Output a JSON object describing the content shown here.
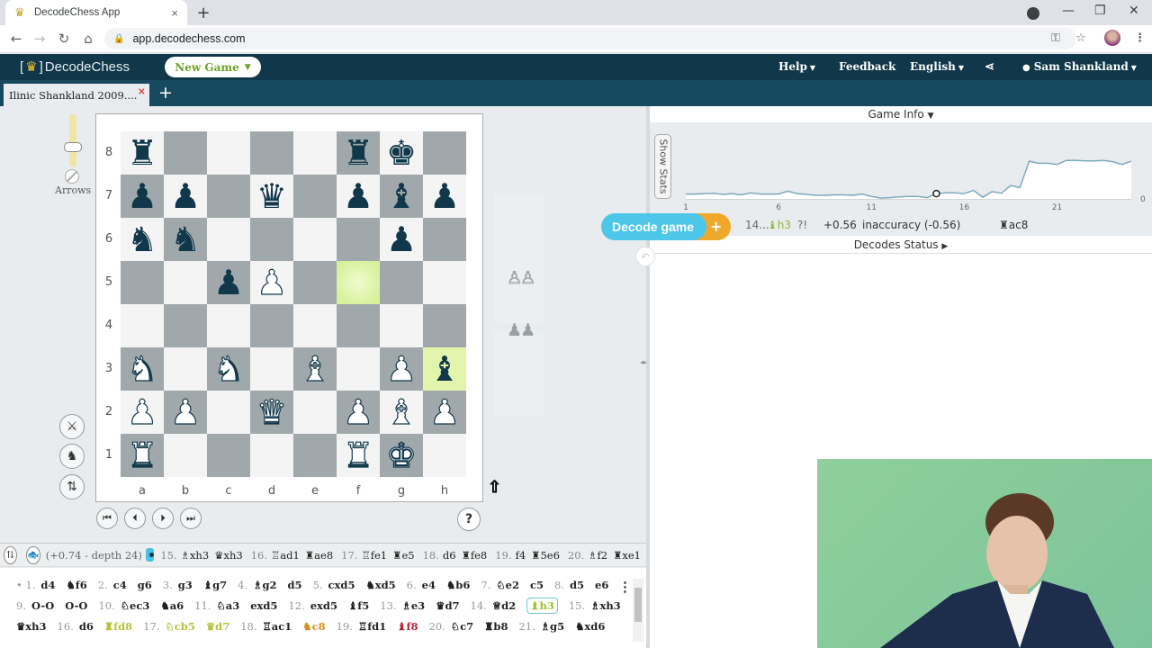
{
  "browser": {
    "tab_title": "DecodeChess App",
    "tab_close": "×",
    "new_tab": "+",
    "url": "app.decodechess.com",
    "window_controls": {
      "minimize": "—",
      "maximize": "❐",
      "close": "✕"
    }
  },
  "app": {
    "logo_text": "DecodeChess",
    "new_game_label": "New Game",
    "nav": {
      "help": "Help",
      "feedback": "Feedback",
      "language": "English",
      "user": "Sam Shankland"
    },
    "game_tab": {
      "label": "Ilinic Shankland 2009....",
      "close": "×",
      "add": "+"
    }
  },
  "board": {
    "arrows_label": "Arrows",
    "arrows_slider_value": 0.25,
    "ranks": [
      "8",
      "7",
      "6",
      "5",
      "4",
      "3",
      "2",
      "1"
    ],
    "files": [
      "a",
      "b",
      "c",
      "d",
      "e",
      "f",
      "g",
      "h"
    ],
    "position": [
      [
        "bR",
        "",
        "",
        "",
        "",
        "bR",
        "bK",
        ""
      ],
      [
        "bP",
        "bP",
        "",
        "bQ",
        "",
        "bP",
        "bB",
        "bP"
      ],
      [
        "bN",
        "bN",
        "",
        "",
        "",
        "",
        "bP",
        ""
      ],
      [
        "",
        "",
        "bP",
        "wP",
        "",
        "",
        "",
        ""
      ],
      [
        "",
        "",
        "",
        "",
        "",
        "",
        "",
        ""
      ],
      [
        "wN",
        "",
        "wN",
        "",
        "wB",
        "",
        "wP",
        "bB"
      ],
      [
        "wP",
        "wP",
        "",
        "wQ",
        "",
        "wP",
        "wB",
        "wP"
      ],
      [
        "wR",
        "",
        "",
        "",
        "",
        "wR",
        "wK",
        ""
      ]
    ],
    "highlighted_squares": [
      "f5",
      "h3"
    ],
    "captured_white": "♙♙",
    "captured_black": "♟♟",
    "help_label": "?",
    "side_buttons": [
      "sword-icon",
      "knights-icon",
      "flip-icon"
    ],
    "nav_buttons": [
      "⏮",
      "⏴",
      "⏵",
      "⏭"
    ]
  },
  "engine_line": {
    "eval": "(+0.74 - depth 24)",
    "moves": [
      {
        "num": "15.",
        "san": "♗xh3"
      },
      {
        "num": "",
        "san": "♛xh3"
      },
      {
        "num": "16.",
        "san": "♖ad1"
      },
      {
        "num": "",
        "san": "♜ae8"
      },
      {
        "num": "17.",
        "san": "♖fe1"
      },
      {
        "num": "",
        "san": "♜e5"
      },
      {
        "num": "18.",
        "san": "d6"
      },
      {
        "num": "",
        "san": "♜fe8"
      },
      {
        "num": "19.",
        "san": "f4"
      },
      {
        "num": "",
        "san": "♜5e6"
      },
      {
        "num": "20.",
        "san": "♗f2"
      },
      {
        "num": "",
        "san": "♜xe1"
      }
    ]
  },
  "move_list": {
    "rows": [
      [
        {
          "t": "num",
          "v": "• 1."
        },
        {
          "t": "m",
          "v": "d4"
        },
        {
          "t": "m",
          "v": "♞f6"
        },
        {
          "t": "num",
          "v": "2."
        },
        {
          "t": "m",
          "v": "c4"
        },
        {
          "t": "m",
          "v": "g6"
        },
        {
          "t": "num",
          "v": "3."
        },
        {
          "t": "m",
          "v": "g3"
        },
        {
          "t": "m",
          "v": "♝g7"
        },
        {
          "t": "num",
          "v": "4."
        },
        {
          "t": "m",
          "v": "♗g2"
        },
        {
          "t": "m",
          "v": "d5"
        },
        {
          "t": "num",
          "v": "5."
        },
        {
          "t": "m",
          "v": "cxd5"
        },
        {
          "t": "m",
          "v": "♞xd5"
        },
        {
          "t": "num",
          "v": "6."
        },
        {
          "t": "m",
          "v": "e4"
        },
        {
          "t": "m",
          "v": "♞b6"
        },
        {
          "t": "num",
          "v": "7."
        },
        {
          "t": "m",
          "v": "♘e2"
        },
        {
          "t": "m",
          "v": "c5"
        },
        {
          "t": "num",
          "v": "8."
        },
        {
          "t": "m",
          "v": "d5"
        },
        {
          "t": "m",
          "v": "e6"
        }
      ],
      [
        {
          "t": "num",
          "v": "9."
        },
        {
          "t": "m",
          "v": "O-O"
        },
        {
          "t": "m",
          "v": "O-O"
        },
        {
          "t": "num",
          "v": "10."
        },
        {
          "t": "m",
          "v": "♘ec3"
        },
        {
          "t": "m",
          "v": "♞a6"
        },
        {
          "t": "num",
          "v": "11."
        },
        {
          "t": "m",
          "v": "♘a3"
        },
        {
          "t": "m",
          "v": "exd5"
        },
        {
          "t": "num",
          "v": "12."
        },
        {
          "t": "m",
          "v": "exd5"
        },
        {
          "t": "m",
          "v": "♝f5"
        },
        {
          "t": "num",
          "v": "13."
        },
        {
          "t": "m",
          "v": "♗e3"
        },
        {
          "t": "m",
          "v": "♛d7"
        },
        {
          "t": "num",
          "v": "14."
        },
        {
          "t": "m",
          "v": "♕d2"
        },
        {
          "t": "m",
          "v": "♝h3",
          "c": "current"
        },
        {
          "t": "num",
          "v": "15."
        },
        {
          "t": "m",
          "v": "♗xh3"
        }
      ],
      [
        {
          "t": "m",
          "v": "♛xh3"
        },
        {
          "t": "num",
          "v": "16."
        },
        {
          "t": "m",
          "v": "d6"
        },
        {
          "t": "m",
          "v": "♜fd8",
          "c": "lightgreen"
        },
        {
          "t": "num",
          "v": "17."
        },
        {
          "t": "m",
          "v": "♘cb5",
          "c": "lightgreen"
        },
        {
          "t": "m",
          "v": "♛d7",
          "c": "lightgreen"
        },
        {
          "t": "num",
          "v": "18."
        },
        {
          "t": "m",
          "v": "♖ac1"
        },
        {
          "t": "m",
          "v": "♞c8",
          "c": "orange"
        },
        {
          "t": "num",
          "v": "19."
        },
        {
          "t": "m",
          "v": "♖fd1"
        },
        {
          "t": "m",
          "v": "♝f8",
          "c": "red"
        },
        {
          "t": "num",
          "v": "20."
        },
        {
          "t": "m",
          "v": "♘c7"
        },
        {
          "t": "m",
          "v": "♜b8"
        },
        {
          "t": "num",
          "v": "21."
        },
        {
          "t": "m",
          "v": "♗g5"
        },
        {
          "t": "m",
          "v": "♞xd6"
        }
      ]
    ],
    "menu_icon": "⋮"
  },
  "right_panel": {
    "game_info_label": "Game Info",
    "show_stats_label": "Show Stats",
    "decode_game_label": "Decode game",
    "decode_plus": "+",
    "current_move": {
      "number": "14...",
      "san": "♝h3",
      "annotation": "?!",
      "eval": "+0.56",
      "verdict": "inaccuracy (-0.56)",
      "best_move": "♜ac8"
    },
    "decodes_status_label": "Decodes Status"
  },
  "chart_data": {
    "type": "area",
    "title": "",
    "xlabel": "",
    "ylabel": "",
    "x_ticks": [
      1,
      6,
      11,
      16,
      21
    ],
    "y_ticks": [
      0
    ],
    "xlim": [
      1,
      25
    ],
    "ylim": [
      0,
      1.1
    ],
    "grid": false,
    "series": [
      {
        "name": "evaluation",
        "x": [
          1,
          1.5,
          2,
          2.5,
          3,
          3.5,
          4,
          4.5,
          5,
          5.5,
          6,
          6.5,
          7,
          7.5,
          8,
          8.5,
          9,
          9.5,
          10,
          10.5,
          11,
          11.5,
          12,
          12.5,
          13,
          13.5,
          14,
          14.5,
          15,
          15.5,
          16,
          16.5,
          17,
          17.5,
          18,
          18.5,
          19,
          19.5,
          20,
          20.5,
          21,
          21.5,
          22,
          22.5,
          23,
          23.5,
          24,
          24.5,
          25
        ],
        "values": [
          0.12,
          0.12,
          0.13,
          0.14,
          0.11,
          0.13,
          0.1,
          0.15,
          0.12,
          0.12,
          0.12,
          0.19,
          0.13,
          0.11,
          0.09,
          0.09,
          0.1,
          0.1,
          0.09,
          0.12,
          0.06,
          0.02,
          0.03,
          0.05,
          0.06,
          0.06,
          0.03,
          0.13,
          0.15,
          0.15,
          0.13,
          0.21,
          0.04,
          0.18,
          0.14,
          0.33,
          0.28,
          0.93,
          0.88,
          0.88,
          0.85,
          0.95,
          0.95,
          0.94,
          0.94,
          0.95,
          0.92,
          0.85,
          0.93
        ]
      }
    ],
    "current_marker_x": 14.5,
    "legend": "none"
  }
}
